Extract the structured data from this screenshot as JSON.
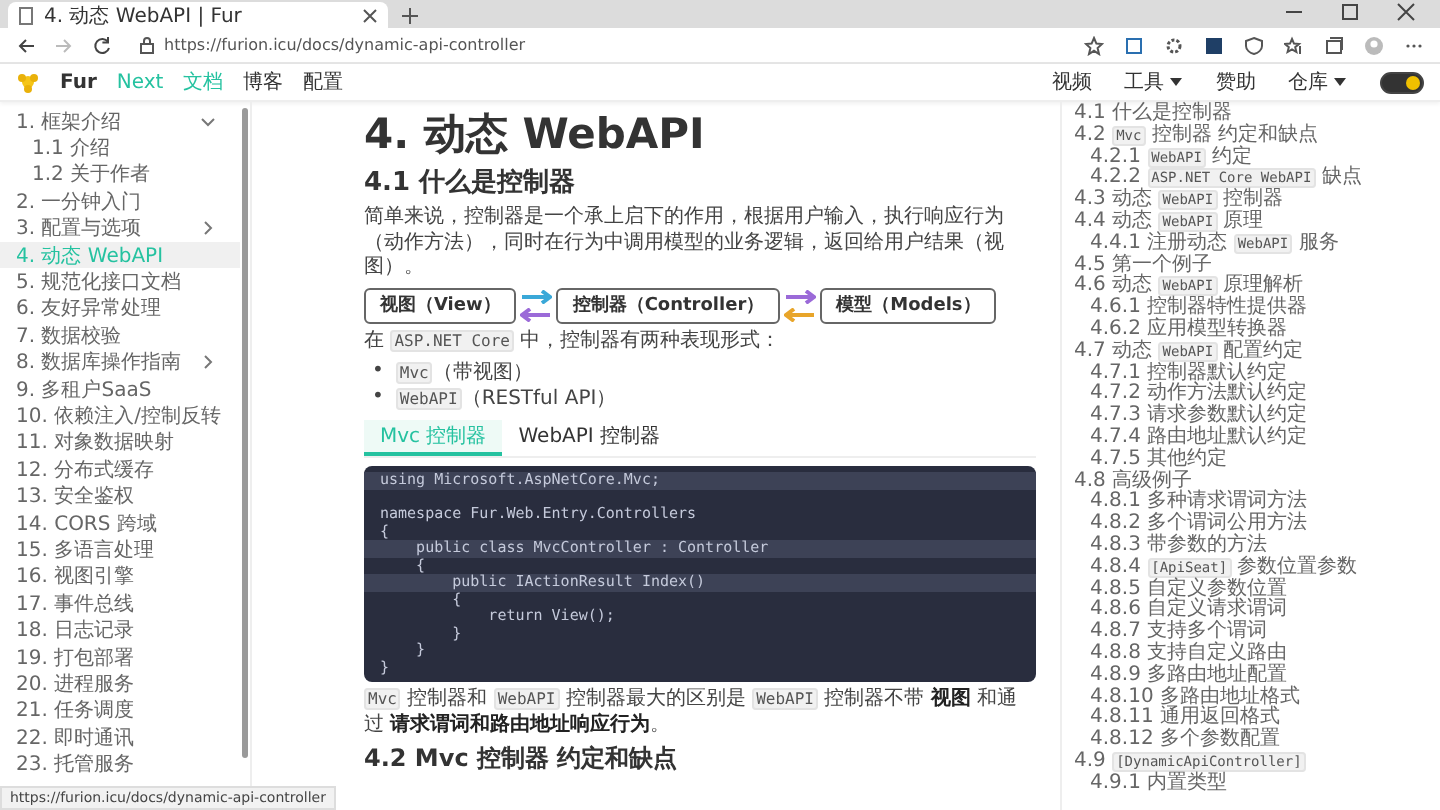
{
  "browser": {
    "tab_title": "4. 动态 WebAPI | Fur",
    "url": "https://furion.icu/docs/dynamic-api-controller",
    "status_url": "https://furion.icu/docs/dynamic-api-controller"
  },
  "nav": {
    "site_name": "Fur",
    "links": [
      {
        "label": "Next",
        "kind": "version",
        "selected": false
      },
      {
        "label": "文档",
        "kind": "link",
        "selected": true
      },
      {
        "label": "博客",
        "kind": "link",
        "selected": false
      },
      {
        "label": "配置",
        "kind": "link",
        "selected": false
      }
    ],
    "right_links": [
      {
        "label": "视频",
        "kind": "link"
      },
      {
        "label": "工具",
        "kind": "dropdown"
      },
      {
        "label": "赞助",
        "kind": "link"
      },
      {
        "label": "仓库",
        "kind": "dropdown"
      }
    ],
    "theme_toggle": {
      "on": true
    }
  },
  "sidebar": {
    "items": [
      {
        "label": "1. 框架介绍",
        "kind": "group",
        "expanded": true,
        "selected": false,
        "children": [
          {
            "label": "1.1 介绍",
            "kind": "page",
            "selected": false
          },
          {
            "label": "1.2 关于作者",
            "kind": "page",
            "selected": false
          }
        ]
      },
      {
        "label": "2. 一分钟入门",
        "kind": "page",
        "selected": false
      },
      {
        "label": "3. 配置与选项",
        "kind": "group",
        "expanded": false,
        "selected": false
      },
      {
        "label": "4. 动态 WebAPI",
        "kind": "page",
        "selected": true
      },
      {
        "label": "5. 规范化接口文档",
        "kind": "page",
        "selected": false
      },
      {
        "label": "6. 友好异常处理",
        "kind": "page",
        "selected": false
      },
      {
        "label": "7. 数据校验",
        "kind": "page",
        "selected": false
      },
      {
        "label": "8. 数据库操作指南",
        "kind": "group",
        "expanded": false,
        "selected": false
      },
      {
        "label": "9. 多租户SaaS",
        "kind": "page",
        "selected": false
      },
      {
        "label": "10. 依赖注入/控制反转",
        "kind": "page",
        "selected": false
      },
      {
        "label": "11. 对象数据映射",
        "kind": "page",
        "selected": false
      },
      {
        "label": "12. 分布式缓存",
        "kind": "page",
        "selected": false
      },
      {
        "label": "13. 安全鉴权",
        "kind": "page",
        "selected": false
      },
      {
        "label": "14. CORS 跨域",
        "kind": "page",
        "selected": false
      },
      {
        "label": "15. 多语言处理",
        "kind": "page",
        "selected": false
      },
      {
        "label": "16. 视图引擎",
        "kind": "page",
        "selected": false
      },
      {
        "label": "17. 事件总线",
        "kind": "page",
        "selected": false
      },
      {
        "label": "18. 日志记录",
        "kind": "page",
        "selected": false
      },
      {
        "label": "19. 打包部署",
        "kind": "page",
        "selected": false
      },
      {
        "label": "20. 进程服务",
        "kind": "page",
        "selected": false
      },
      {
        "label": "21. 任务调度",
        "kind": "page",
        "selected": false
      },
      {
        "label": "22. 即时通讯",
        "kind": "page",
        "selected": false
      },
      {
        "label": "23. 托管服务",
        "kind": "page",
        "selected": false
      }
    ]
  },
  "article": {
    "title": "4. 动态 WebAPI",
    "section_title": "4.1 什么是控制器",
    "intro": "简单来说，控制器是一个承上启下的作用，根据用户输入，执行响应行为（动作方法），同时在行为中调用模型的业务逻辑，返回给用户结果（视图）。",
    "diagram": {
      "nodes": [
        "视图（View）",
        "控制器（Controller）",
        "模型（Models）"
      ],
      "links": [
        [
          {
            "kind": "right",
            "color": "#3aa8d8"
          },
          {
            "kind": "left",
            "color": "#9b6ad8"
          }
        ],
        [
          {
            "kind": "right",
            "color": "#9b6ad8"
          },
          {
            "kind": "left",
            "color": "#e8a52a"
          }
        ]
      ]
    },
    "forms_line": {
      "segments": [
        {
          "kind": "text",
          "text": "在 "
        },
        {
          "kind": "code",
          "text": "ASP.NET Core"
        },
        {
          "kind": "text",
          "text": " 中，控制器有两种表现形式："
        }
      ]
    },
    "bullets": [
      {
        "marker": "•",
        "segments": [
          {
            "kind": "code",
            "text": "Mvc"
          },
          {
            "kind": "text",
            "text": "（带视图）"
          }
        ]
      },
      {
        "marker": "•",
        "segments": [
          {
            "kind": "code",
            "text": "WebAPI"
          },
          {
            "kind": "text",
            "text": "（RESTful API）"
          }
        ]
      }
    ],
    "code_tabs": [
      {
        "label": "Mvc 控制器",
        "selected": true
      },
      {
        "label": "WebAPI 控制器",
        "selected": false
      }
    ],
    "code_lines": [
      {
        "text": "using Microsoft.AspNetCore.Mvc;",
        "highlighted": true
      },
      {
        "text": "namespace Fur.Web.Entry.Controllers",
        "highlighted": false,
        "blank_before": true
      },
      {
        "text": "{",
        "highlighted": false
      },
      {
        "text": "    public class MvcController : Controller",
        "highlighted": true
      },
      {
        "text": "    {",
        "highlighted": false
      },
      {
        "text": "        public IActionResult Index()",
        "highlighted": true
      },
      {
        "text": "        {",
        "highlighted": false
      },
      {
        "text": "            return View();",
        "highlighted": false
      },
      {
        "text": "        }",
        "highlighted": false
      },
      {
        "text": "    }",
        "highlighted": false
      },
      {
        "text": "}",
        "highlighted": false
      }
    ],
    "summary": {
      "segments": [
        {
          "kind": "code",
          "text": "Mvc"
        },
        {
          "kind": "text",
          "text": " 控制器和 "
        },
        {
          "kind": "code",
          "text": "WebAPI"
        },
        {
          "kind": "text",
          "text": " 控制器最大的区别是 "
        },
        {
          "kind": "code",
          "text": "WebAPI"
        },
        {
          "kind": "text",
          "text": " 控制器不带 "
        },
        {
          "kind": "strong",
          "text": "视图"
        },
        {
          "kind": "text",
          "text": " 和通过 "
        },
        {
          "kind": "strong",
          "text": "请求谓词和路由地址响应行为"
        },
        {
          "kind": "text",
          "text": "。"
        }
      ]
    },
    "next_heading": "4.2 Mvc 控制器 约定和缺点"
  },
  "toc": {
    "items": [
      {
        "text": "4.1 什么是控制器"
      },
      {
        "segments": [
          {
            "kind": "text",
            "text": "4.2 "
          },
          {
            "kind": "code",
            "text": "Mvc"
          },
          {
            "kind": "text",
            "text": " 控制器 约定和缺点"
          }
        ],
        "children": [
          {
            "segments": [
              {
                "kind": "text",
                "text": "4.2.1 "
              },
              {
                "kind": "code",
                "text": "WebAPI"
              },
              {
                "kind": "text",
                "text": " 约定"
              }
            ]
          },
          {
            "segments": [
              {
                "kind": "text",
                "text": "4.2.2 "
              },
              {
                "kind": "code",
                "text": "ASP.NET Core WebAPI"
              },
              {
                "kind": "text",
                "text": " 缺点"
              }
            ]
          }
        ]
      },
      {
        "segments": [
          {
            "kind": "text",
            "text": "4.3 动态 "
          },
          {
            "kind": "code",
            "text": "WebAPI"
          },
          {
            "kind": "text",
            "text": " 控制器"
          }
        ]
      },
      {
        "segments": [
          {
            "kind": "text",
            "text": "4.4 动态 "
          },
          {
            "kind": "code",
            "text": "WebAPI"
          },
          {
            "kind": "text",
            "text": " 原理"
          }
        ],
        "children": [
          {
            "segments": [
              {
                "kind": "text",
                "text": "4.4.1 注册动态 "
              },
              {
                "kind": "code",
                "text": "WebAPI"
              },
              {
                "kind": "text",
                "text": " 服务"
              }
            ]
          }
        ]
      },
      {
        "text": "4.5 第一个例子"
      },
      {
        "segments": [
          {
            "kind": "text",
            "text": "4.6 动态 "
          },
          {
            "kind": "code",
            "text": "WebAPI"
          },
          {
            "kind": "text",
            "text": " 原理解析"
          }
        ],
        "children": [
          {
            "text": "4.6.1 控制器特性提供器"
          },
          {
            "text": "4.6.2 应用模型转换器"
          }
        ]
      },
      {
        "segments": [
          {
            "kind": "text",
            "text": "4.7 动态 "
          },
          {
            "kind": "code",
            "text": "WebAPI"
          },
          {
            "kind": "text",
            "text": " 配置约定"
          }
        ],
        "children": [
          {
            "text": "4.7.1 控制器默认约定"
          },
          {
            "text": "4.7.2 动作方法默认约定"
          },
          {
            "text": "4.7.3 请求参数默认约定"
          },
          {
            "text": "4.7.4 路由地址默认约定"
          },
          {
            "text": "4.7.5 其他约定"
          }
        ]
      },
      {
        "text": "4.8 高级例子",
        "children": [
          {
            "text": "4.8.1 多种请求谓词方法"
          },
          {
            "text": "4.8.2 多个谓词公用方法"
          },
          {
            "text": "4.8.3 带参数的方法"
          },
          {
            "segments": [
              {
                "kind": "text",
                "text": "4.8.4 "
              },
              {
                "kind": "code",
                "text": "[ApiSeat]"
              },
              {
                "kind": "text",
                "text": " 参数位置参数"
              }
            ]
          },
          {
            "text": "4.8.5 自定义参数位置"
          },
          {
            "text": "4.8.6 自定义请求谓词"
          },
          {
            "text": "4.8.7 支持多个谓词"
          },
          {
            "text": "4.8.8 支持自定义路由"
          },
          {
            "text": "4.8.9 多路由地址配置"
          },
          {
            "text": "4.8.10 多路由地址格式"
          },
          {
            "text": "4.8.11 通用返回格式"
          },
          {
            "text": "4.8.12 多个参数配置"
          }
        ]
      },
      {
        "segments": [
          {
            "kind": "text",
            "text": "4.9 "
          },
          {
            "kind": "code",
            "text": "[DynamicApiController]"
          }
        ],
        "children": [
          {
            "text": "4.9.1 内置类型"
          }
        ]
      }
    ]
  }
}
